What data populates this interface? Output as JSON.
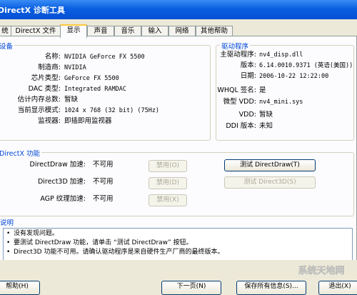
{
  "window": {
    "title": "DirectX 诊断工具"
  },
  "tabs": [
    {
      "label": "统"
    },
    {
      "label": "DirectX 文件"
    },
    {
      "label": "显示"
    },
    {
      "label": "声音"
    },
    {
      "label": "音乐"
    },
    {
      "label": "输入"
    },
    {
      "label": "网络"
    },
    {
      "label": "其他帮助"
    }
  ],
  "device": {
    "title": "设备",
    "rows": [
      {
        "label": "名称:",
        "value": "NVIDIA GeForce FX 5500"
      },
      {
        "label": "制造商:",
        "value": "NVIDIA"
      },
      {
        "label": "芯片类型:",
        "value": "GeForce FX 5500"
      },
      {
        "label": "DAC 类型:",
        "value": "Integrated RAMDAC"
      },
      {
        "label": "估计内存总数:",
        "value": "暂缺"
      },
      {
        "label": "当前显示模式:",
        "value": "1024 x 768 (32 bit) (75Hz)"
      },
      {
        "label": "监视器:",
        "value": "即插即用监视器"
      }
    ]
  },
  "drivers": {
    "title": "驱动程序",
    "rows": [
      {
        "label": "主驱动程序:",
        "value": "nv4_disp.dll"
      },
      {
        "label": "版本:",
        "value": "6.14.0010.9371 (英语(美国))"
      },
      {
        "label": "日期:",
        "value": "2006-10-22 12:22:00"
      },
      {
        "label": "WHQL 签名:",
        "value": "是"
      },
      {
        "label": "微型 VDD:",
        "value": "nv4_mini.sys"
      },
      {
        "label": "VDD:",
        "value": "暂缺"
      },
      {
        "label": "DDI 版本:",
        "value": "未知"
      }
    ]
  },
  "features": {
    "title": "DirectX 功能",
    "rows": [
      {
        "label": "DirectDraw 加速:",
        "status": "不可用",
        "button": "禁用(O)"
      },
      {
        "label": "Direct3D 加速:",
        "status": "不可用",
        "button": "禁用(D)"
      },
      {
        "label": "AGP 纹理加速:",
        "status": "不可用",
        "button": "禁用(X)"
      }
    ],
    "test_directdraw": "测试 DirectDraw(T)",
    "test_direct3d": "测试 Direct3D(S)"
  },
  "notes": {
    "title": "说明",
    "items": [
      "没有发现问题。",
      "要测试 DirectDraw 功能，请单击 “测试 DirectDraw” 按钮。",
      "Direct3D 功能不可用。请确认驱动程序是来自硬件生产厂商的最终版本。"
    ]
  },
  "footer": {
    "help": "帮助(H)",
    "next": "下一页(N)",
    "save": "保存所有信息(S)...",
    "exit": "退出(X)"
  },
  "watermark": {
    "text": "系统天地网"
  },
  "colors": {
    "titlebar": "#0a5fe0",
    "group_title": "#0046d5",
    "tab_highlight": "#ffc83c",
    "face": "#ece9d8"
  }
}
